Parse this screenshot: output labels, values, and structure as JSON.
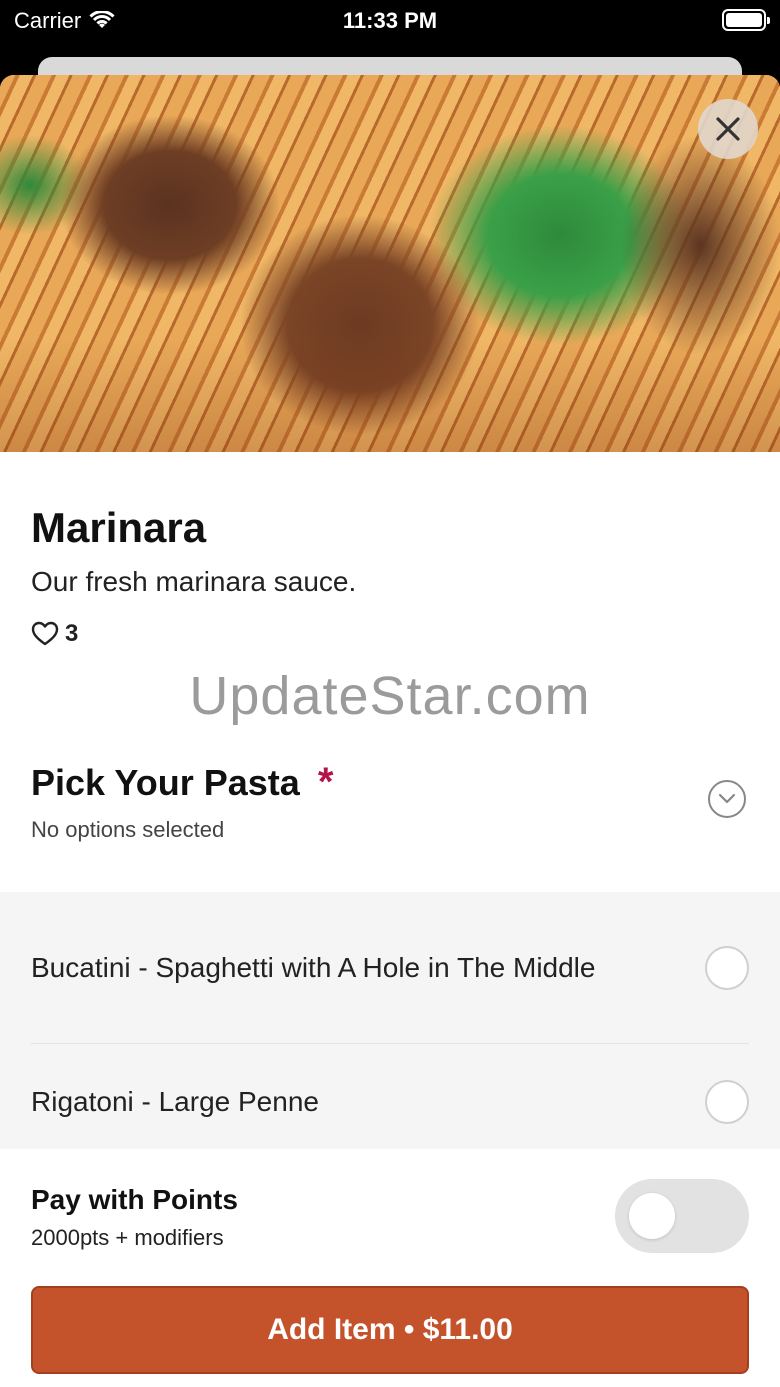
{
  "status_bar": {
    "carrier": "Carrier",
    "time": "11:33 PM"
  },
  "item": {
    "title": "Marinara",
    "description": "Our fresh marinara sauce.",
    "likes": "3"
  },
  "watermark": "UpdateStar.com",
  "section": {
    "title": "Pick Your Pasta",
    "required_mark": "*",
    "subtitle": "No options selected",
    "options": [
      {
        "label": "Bucatini - Spaghetti with A Hole in The Middle",
        "selected": false
      },
      {
        "label": "Rigatoni - Large Penne",
        "selected": false
      }
    ]
  },
  "footer": {
    "points_title": "Pay with Points",
    "points_subtitle": "2000pts + modifiers",
    "toggle_on": false,
    "add_button": "Add Item • $11.00"
  },
  "colors": {
    "accent": "#c4532b",
    "required": "#b41348"
  }
}
